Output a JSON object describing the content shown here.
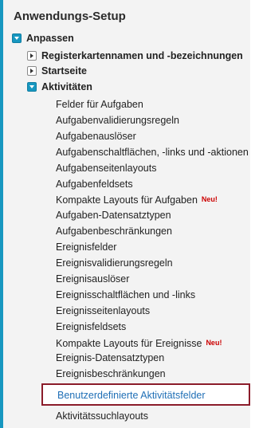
{
  "colors": {
    "accent": "#1797c0",
    "highlight_border": "#8b1c2a",
    "new_badge": "#cc0000",
    "link": "#1f6fb6"
  },
  "title": "Anwendungs-Setup",
  "tree": {
    "anpassen": "Anpassen",
    "registerkarten": "Registerkartennamen und -bezeichnungen",
    "startseite": "Startseite",
    "aktivitaeten": "Aktivitäten",
    "items": [
      {
        "label": "Felder für Aufgaben",
        "badge": ""
      },
      {
        "label": "Aufgabenvalidierungsregeln",
        "badge": ""
      },
      {
        "label": "Aufgabenauslöser",
        "badge": ""
      },
      {
        "label": "Aufgabenschaltflächen, -links und -aktionen",
        "badge": ""
      },
      {
        "label": "Aufgabenseitenlayouts",
        "badge": ""
      },
      {
        "label": "Aufgabenfeldsets",
        "badge": ""
      },
      {
        "label": "Kompakte Layouts für Aufgaben",
        "badge": "Neu!"
      },
      {
        "label": "Aufgaben-Datensatztypen",
        "badge": ""
      },
      {
        "label": "Aufgabenbeschränkungen",
        "badge": ""
      },
      {
        "label": "Ereignisfelder",
        "badge": ""
      },
      {
        "label": "Ereignisvalidierungsregeln",
        "badge": ""
      },
      {
        "label": "Ereignisauslöser",
        "badge": ""
      },
      {
        "label": "Ereignisschaltflächen und -links",
        "badge": ""
      },
      {
        "label": "Ereignisseitenlayouts",
        "badge": ""
      },
      {
        "label": "Ereignisfeldsets",
        "badge": ""
      },
      {
        "label": "Kompakte Layouts für Ereignisse",
        "badge": "Neu!"
      },
      {
        "label": "Ereignis-Datensatztypen",
        "badge": ""
      },
      {
        "label": "Ereignisbeschränkungen",
        "badge": ""
      }
    ],
    "highlighted": "Benutzerdefinierte Aktivitätsfelder",
    "last_item": "Aktivitätssuchlayouts"
  }
}
